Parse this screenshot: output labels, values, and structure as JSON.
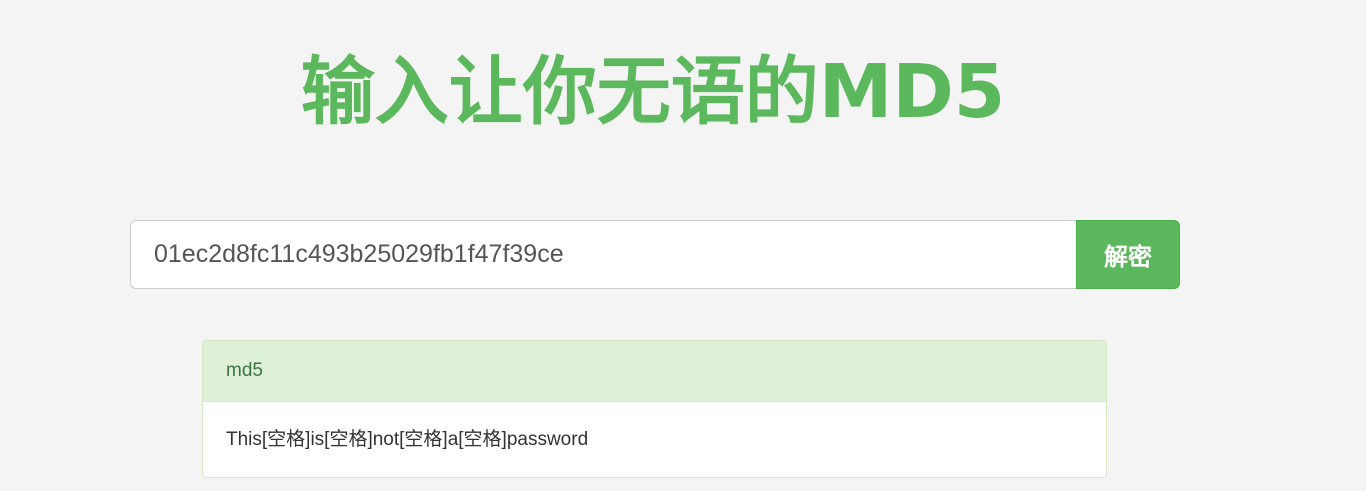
{
  "header": {
    "title": "输入让你无语的MD5"
  },
  "search": {
    "value": "01ec2d8fc11c493b25029fb1f47f39ce",
    "button_label": "解密"
  },
  "result": {
    "heading": "md5",
    "text": "This[空格]is[空格]not[空格]a[空格]password"
  },
  "colors": {
    "accent": "#5cb85c",
    "panel_heading_bg": "#dff0d8",
    "panel_heading_text": "#3c763d",
    "page_bg": "#f4f4f4"
  }
}
